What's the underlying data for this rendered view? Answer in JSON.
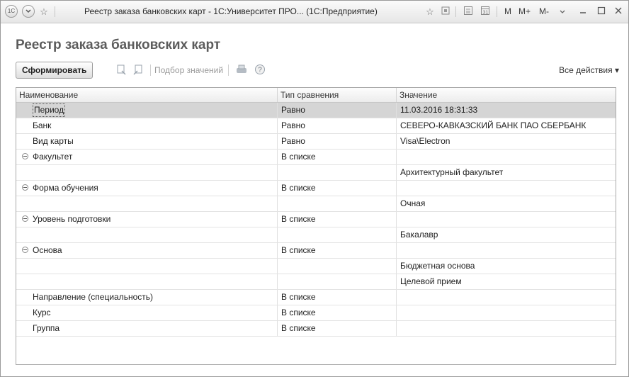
{
  "window": {
    "title": "Реестр заказа банковских карт - 1С:Университет ПРО...  (1С:Предприятие)",
    "app_icon": "1C",
    "buttons": {
      "m": "M",
      "m_plus": "M+",
      "m_minus": "M-"
    }
  },
  "page": {
    "title": "Реестр заказа банковских карт"
  },
  "toolbar": {
    "generate_label": "Сформировать",
    "pick_values_label": "Подбор значений",
    "all_actions_label": "Все действия ▾"
  },
  "table": {
    "columns": [
      "Наименование",
      "Тип сравнения",
      "Значение"
    ],
    "rows": [
      {
        "name": "Период",
        "comparison": "Равно",
        "value": "11.03.2016 18:31:33",
        "selected": true
      },
      {
        "name": "Банк",
        "comparison": "Равно",
        "value": "СЕВЕРО-КАВКАЗСКИЙ БАНК ПАО СБЕРБАНК"
      },
      {
        "name": "Вид карты",
        "comparison": "Равно",
        "value": "Visa\\Electron"
      },
      {
        "name": "Факультет",
        "comparison": "В списке",
        "value": "",
        "group": true
      },
      {
        "name": "",
        "comparison": "",
        "value": "Архитектурный факультет"
      },
      {
        "name": "Форма обучения",
        "comparison": "В списке",
        "value": "",
        "group": true
      },
      {
        "name": "",
        "comparison": "",
        "value": "Очная"
      },
      {
        "name": "Уровень подготовки",
        "comparison": "В списке",
        "value": "",
        "group": true
      },
      {
        "name": "",
        "comparison": "",
        "value": "Бакалавр"
      },
      {
        "name": "Основа",
        "comparison": "В списке",
        "value": "",
        "group": true
      },
      {
        "name": "",
        "comparison": "",
        "value": "Бюджетная основа"
      },
      {
        "name": "",
        "comparison": "",
        "value": "Целевой прием"
      },
      {
        "name": "Направление (специальность)",
        "comparison": "В списке",
        "value": ""
      },
      {
        "name": "Курс",
        "comparison": "В списке",
        "value": ""
      },
      {
        "name": "Группа",
        "comparison": "В списке",
        "value": ""
      }
    ]
  }
}
